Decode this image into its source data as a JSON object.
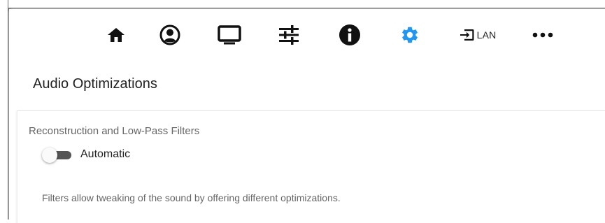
{
  "toolbar": {
    "items": [
      {
        "name": "home",
        "icon": "home-icon"
      },
      {
        "name": "account",
        "icon": "account-circle-icon"
      },
      {
        "name": "display",
        "icon": "monitor-icon"
      },
      {
        "name": "equalizer",
        "icon": "sliders-icon"
      },
      {
        "name": "info",
        "icon": "info-icon"
      },
      {
        "name": "settings",
        "icon": "gear-icon",
        "active": true
      },
      {
        "name": "input",
        "icon": "input-icon",
        "label": "LAN"
      },
      {
        "name": "more",
        "icon": "more-horiz-icon"
      }
    ],
    "lan_label": "LAN",
    "active_color": "#2196F3",
    "icon_color": "#111111"
  },
  "section": {
    "title": "Audio Optimizations"
  },
  "card": {
    "title": "Reconstruction and Low-Pass Filters",
    "toggle_label": "Automatic",
    "toggle_on": false,
    "description": "Filters allow tweaking of the sound by offering different optimizations."
  }
}
